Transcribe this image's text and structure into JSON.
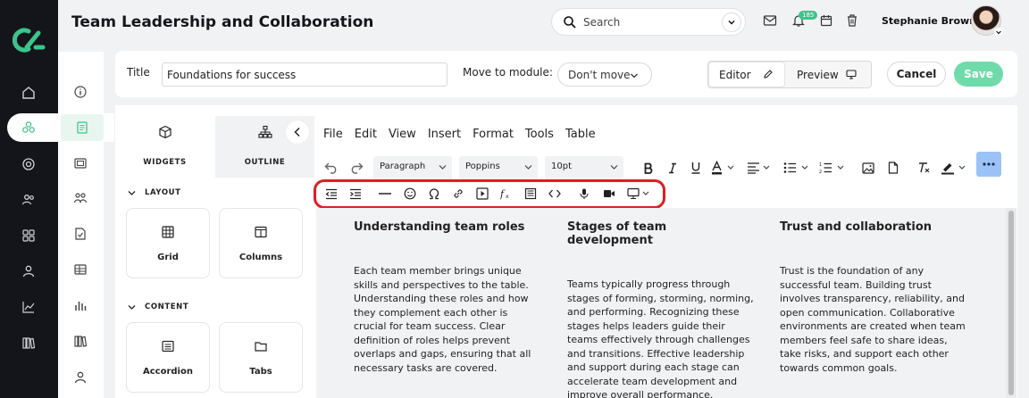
{
  "app": {
    "page_title": "Team Leadership and Collaboration",
    "search_placeholder": "Search",
    "notification_count": "185",
    "user_name": "Stephanie Brown"
  },
  "form": {
    "title_label": "Title",
    "title_value": "Foundations for success",
    "move_label": "Move to module:",
    "move_value": "Don't move",
    "editor_label": "Editor",
    "preview_label": "Preview",
    "cancel_label": "Cancel",
    "save_label": "Save"
  },
  "widgets_panel": {
    "tabs": [
      "WIDGETS",
      "OUTLINE"
    ],
    "layout_title": "LAYOUT",
    "layout_items": [
      "Grid",
      "Columns"
    ],
    "content_title": "CONTENT",
    "content_items": [
      "Accordion",
      "Tabs"
    ]
  },
  "editor": {
    "menu": [
      "File",
      "Edit",
      "View",
      "Insert",
      "Format",
      "Tools",
      "Table"
    ],
    "block_format": "Paragraph",
    "font_family": "Poppins",
    "font_size": "10pt",
    "columns": [
      {
        "heading": "Understanding team roles",
        "body": "Each team member brings unique skills and perspectives to the table. Understanding these roles and how they complement each other is crucial for team success. Clear definition of roles helps prevent overlaps and gaps, ensuring that all necessary tasks are covered."
      },
      {
        "heading": "Stages of team development",
        "body": "Teams typically progress through stages of forming, storming, norming, and performing. Recognizing these stages helps leaders guide their teams effectively through challenges and transitions. Effective leadership and support during each stage can accelerate team development and improve overall performance."
      },
      {
        "heading": "Trust and collaboration",
        "body": "Trust is the foundation of any successful team. Building trust involves transparency, reliability, and open communication. Collaborative environments are created when team members feel safe to share ideas, take risks, and support each other towards common goals."
      }
    ]
  },
  "colors": {
    "accent": "#3cc48b",
    "save_button": "#6fdbaa",
    "sidebar": "#13151b",
    "highlight_ring": "#e31b23",
    "more_button": "#9cc3f7"
  }
}
